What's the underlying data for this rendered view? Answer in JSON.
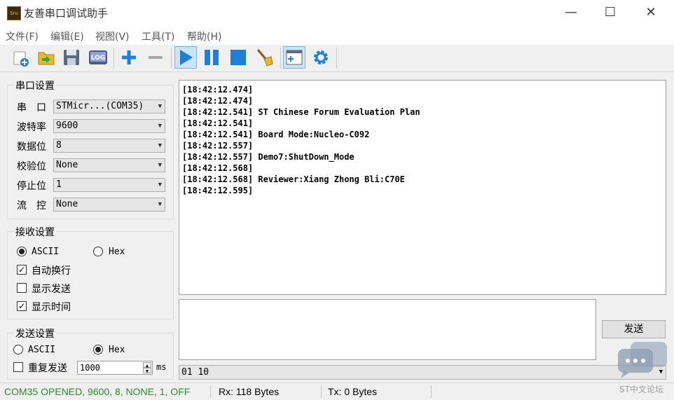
{
  "window": {
    "title": "友善串口调试助手",
    "app_icon_text": "Sru",
    "minimize": "—",
    "maximize": "☐",
    "close": "✕"
  },
  "menu": [
    "文件(F)",
    "编辑(E)",
    "视图(V)",
    "工具(T)",
    "帮助(H)"
  ],
  "toolbar": {
    "log_label": "LOG",
    "icons": [
      "new-session-icon",
      "open-folder-icon",
      "save-icon",
      "log-icon",
      "add-icon",
      "remove-icon",
      "play-icon",
      "pause-icon",
      "stop-icon",
      "clear-broom-icon",
      "add-window-icon",
      "settings-gear-icon"
    ]
  },
  "serial_settings": {
    "title": "串口设置",
    "rows": [
      {
        "label": "串　口",
        "value": "STMicr...(COM35)"
      },
      {
        "label": "波特率",
        "value": "9600"
      },
      {
        "label": "数据位",
        "value": "8"
      },
      {
        "label": "校验位",
        "value": "None"
      },
      {
        "label": "停止位",
        "value": "1"
      },
      {
        "label": "流　控",
        "value": "None"
      }
    ]
  },
  "receive_settings": {
    "title": "接收设置",
    "ascii": "ASCII",
    "hex": "Hex",
    "selected": "ASCII",
    "auto_newline": {
      "label": "自动换行",
      "checked": true
    },
    "show_send": {
      "label": "显示发送",
      "checked": false
    },
    "show_time": {
      "label": "显示时间",
      "checked": true
    }
  },
  "send_settings": {
    "title": "发送设置",
    "ascii": "ASCII",
    "hex": "Hex",
    "selected": "Hex",
    "repeat": {
      "label": "重复发送",
      "checked": false
    },
    "interval": "1000",
    "unit": "ms"
  },
  "receive_log": [
    "[18:42:12.474]",
    "[18:42:12.474]",
    "[18:42:12.541] ST Chinese Forum Evaluation Plan",
    "[18:42:12.541]",
    "[18:42:12.541] Board Mode:Nucleo-C092",
    "[18:42:12.557]",
    "[18:42:12.557] Demo7:ShutDown_Mode",
    "[18:42:12.568]",
    "[18:42:12.568] Reviewer:Xiang Zhong Bli:C70E",
    "[18:42:12.595]"
  ],
  "send": {
    "text": "",
    "button": "发送",
    "history": "01 10"
  },
  "status": {
    "port": "COM35 OPENED, 9600, 8, NONE, 1, OFF",
    "port_color": "#2e8b2e",
    "rx": "Rx: 118 Bytes",
    "tx": "Tx: 0 Bytes"
  },
  "watermark": "ST中文论坛",
  "colors": {
    "accent_blue": "#1e7fd8",
    "active_bg": "#cce4f7"
  }
}
